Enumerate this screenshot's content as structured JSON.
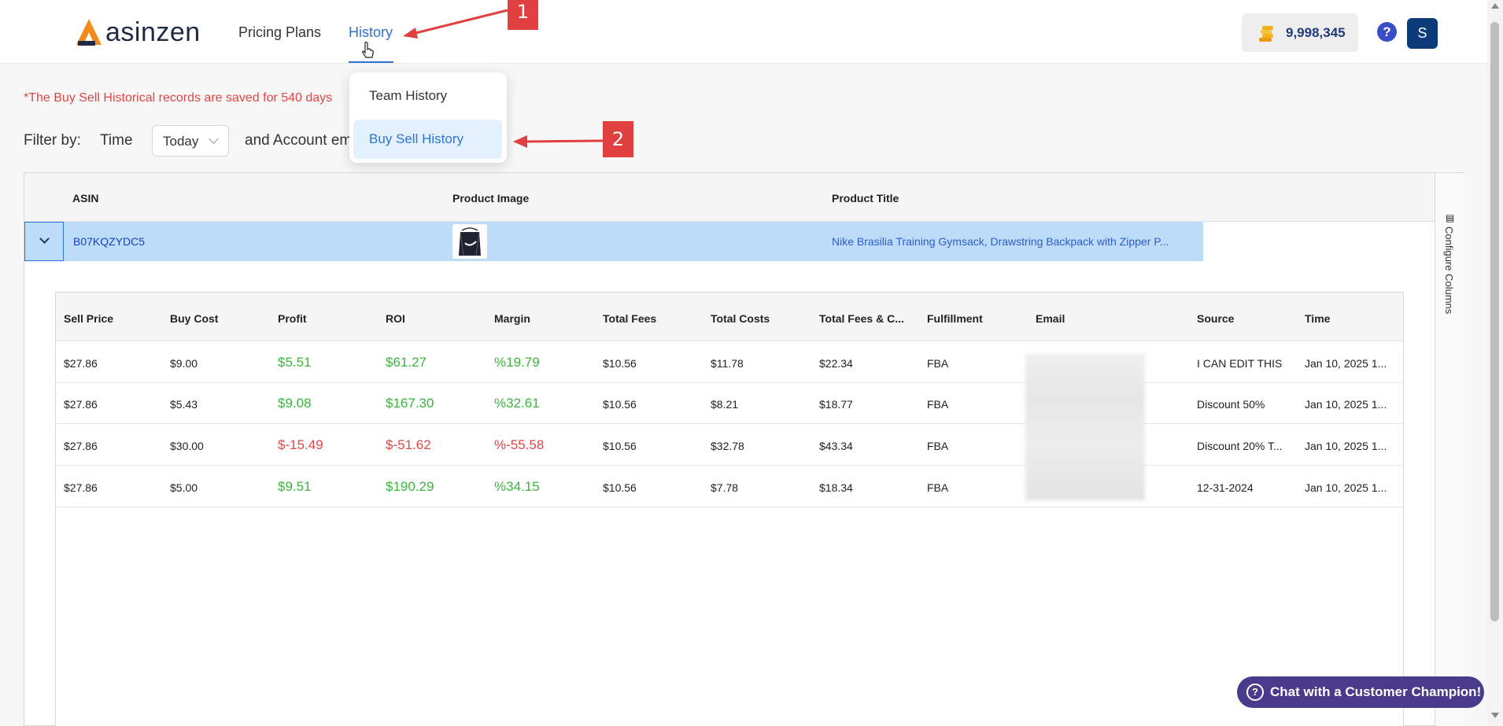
{
  "header": {
    "logo_text": "asinzen",
    "nav": {
      "pricing": "Pricing Plans",
      "history": "History"
    },
    "credits": "9,998,345",
    "help": "?",
    "avatar_initial": "S"
  },
  "history_menu": {
    "items": [
      "Team History",
      "Buy Sell History"
    ],
    "selected": "Buy Sell History"
  },
  "annotations": {
    "step1": "1",
    "step2": "2"
  },
  "notice": "*The Buy Sell Historical records are saved for 540 days",
  "filter": {
    "label": "Filter by:",
    "time_label": "Time",
    "time_value": "Today",
    "account_label": "and Account email"
  },
  "main_table": {
    "columns": [
      "ASIN",
      "Product Image",
      "Product Title"
    ],
    "row": {
      "asin": "B07KQZYDC5",
      "title": "Nike Brasilia Training Gymsack, Drawstring Backpack with Zipper P..."
    },
    "configure_columns": "Configure Columns"
  },
  "sub_table": {
    "columns": [
      "Sell Price",
      "Buy Cost",
      "Profit",
      "ROI",
      "Margin",
      "Total Fees",
      "Total Costs",
      "Total Fees & C...",
      "Fulfillment",
      "Email",
      "Source",
      "Time"
    ],
    "rows": [
      {
        "sell_price": "$27.86",
        "buy_cost": "$9.00",
        "profit": "$5.51",
        "roi": "$61.27",
        "margin": "%19.79",
        "total_fees": "$10.56",
        "total_costs": "$11.78",
        "total_fees_c": "$22.34",
        "fulfillment": "FBA",
        "source": "I CAN EDIT THIS",
        "time": "Jan 10, 2025 1...",
        "positive": true
      },
      {
        "sell_price": "$27.86",
        "buy_cost": "$5.43",
        "profit": "$9.08",
        "roi": "$167.30",
        "margin": "%32.61",
        "total_fees": "$10.56",
        "total_costs": "$8.21",
        "total_fees_c": "$18.77",
        "fulfillment": "FBA",
        "source": "Discount 50%",
        "time": "Jan 10, 2025 1...",
        "positive": true
      },
      {
        "sell_price": "$27.86",
        "buy_cost": "$30.00",
        "profit": "$-15.49",
        "roi": "$-51.62",
        "margin": "%-55.58",
        "total_fees": "$10.56",
        "total_costs": "$32.78",
        "total_fees_c": "$43.34",
        "fulfillment": "FBA",
        "source": "Discount 20% T...",
        "time": "Jan 10, 2025 1...",
        "positive": false
      },
      {
        "sell_price": "$27.86",
        "buy_cost": "$5.00",
        "profit": "$9.51",
        "roi": "$190.29",
        "margin": "%34.15",
        "total_fees": "$10.56",
        "total_costs": "$7.78",
        "total_fees_c": "$18.34",
        "fulfillment": "FBA",
        "source": "12-31-2024",
        "time": "Jan 10, 2025 1...",
        "positive": true
      }
    ]
  },
  "chat": {
    "label": "Chat with a Customer Champion!"
  },
  "colors": {
    "accent": "#2f74d0",
    "positive": "#3bb53b",
    "negative": "#e04646",
    "annotation": "#e04040",
    "chat": "#4a3a8c"
  }
}
